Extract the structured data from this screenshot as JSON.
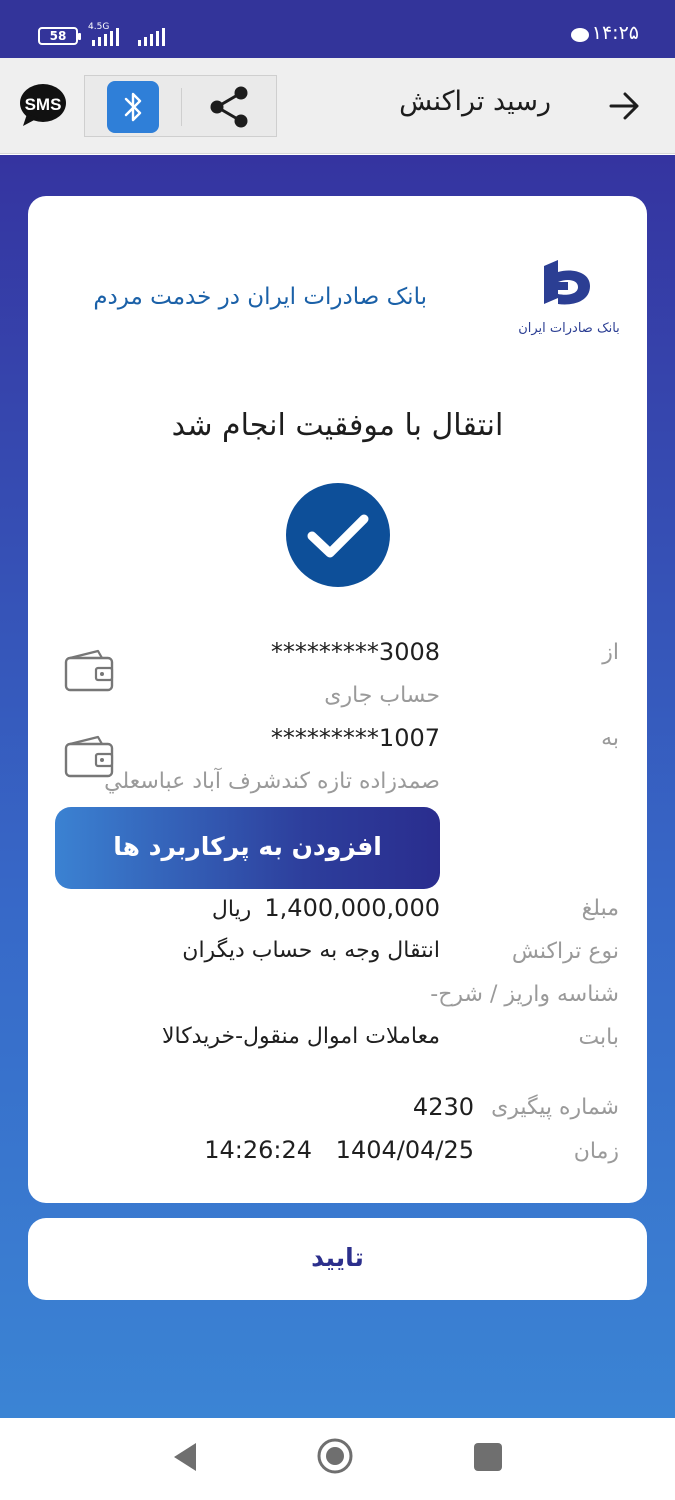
{
  "status_bar": {
    "battery": "58",
    "network": "4.5G",
    "time": "۱۴:۲۵"
  },
  "header": {
    "title": "رسید تراکنش",
    "sms_label": "SMS"
  },
  "receipt": {
    "slogan": "بانک صادرات ایران در خدمت مردم",
    "logo_text": "بانک صادرات ایران",
    "success_message": "انتقال با موفقیت انجام شد",
    "from": {
      "label": "از",
      "account": "*********3008",
      "account_type": "حساب جاری"
    },
    "to": {
      "label": "به",
      "account": "*********1007",
      "owner": "صمدزاده تازه کندشرف آباد عباسعلي"
    },
    "add_favorite_button": "افزودن به پرکاربرد ها",
    "amount": {
      "label": "مبلغ",
      "value": "1,400,000,000",
      "unit": "ریال"
    },
    "transaction_type": {
      "label": "نوع تراکنش",
      "value": "انتقال وجه به حساب دیگران"
    },
    "deposit_id": {
      "label": "شناسه واریز / شرح-"
    },
    "purpose": {
      "label": "بابت",
      "value": "معاملات اموال منقول-خریدکالا"
    },
    "tracking": {
      "label": "شماره پیگیری",
      "value": "4230"
    },
    "datetime": {
      "label": "زمان",
      "date": "1404/04/25",
      "time": "14:26:24"
    }
  },
  "confirm_button": "تایید",
  "colors": {
    "status_bar": "#33349a",
    "bank_blue": "#0d4f99",
    "slogan_blue": "#1b61a8",
    "bluetooth_button": "#2f7fd8",
    "confirm_text": "#2c2f8c"
  },
  "icons": {
    "back": "arrow-right-icon",
    "share": "share-icon",
    "bluetooth": "bluetooth-icon",
    "sms": "sms-icon",
    "wallet": "wallet-icon",
    "check": "checkmark-icon"
  }
}
